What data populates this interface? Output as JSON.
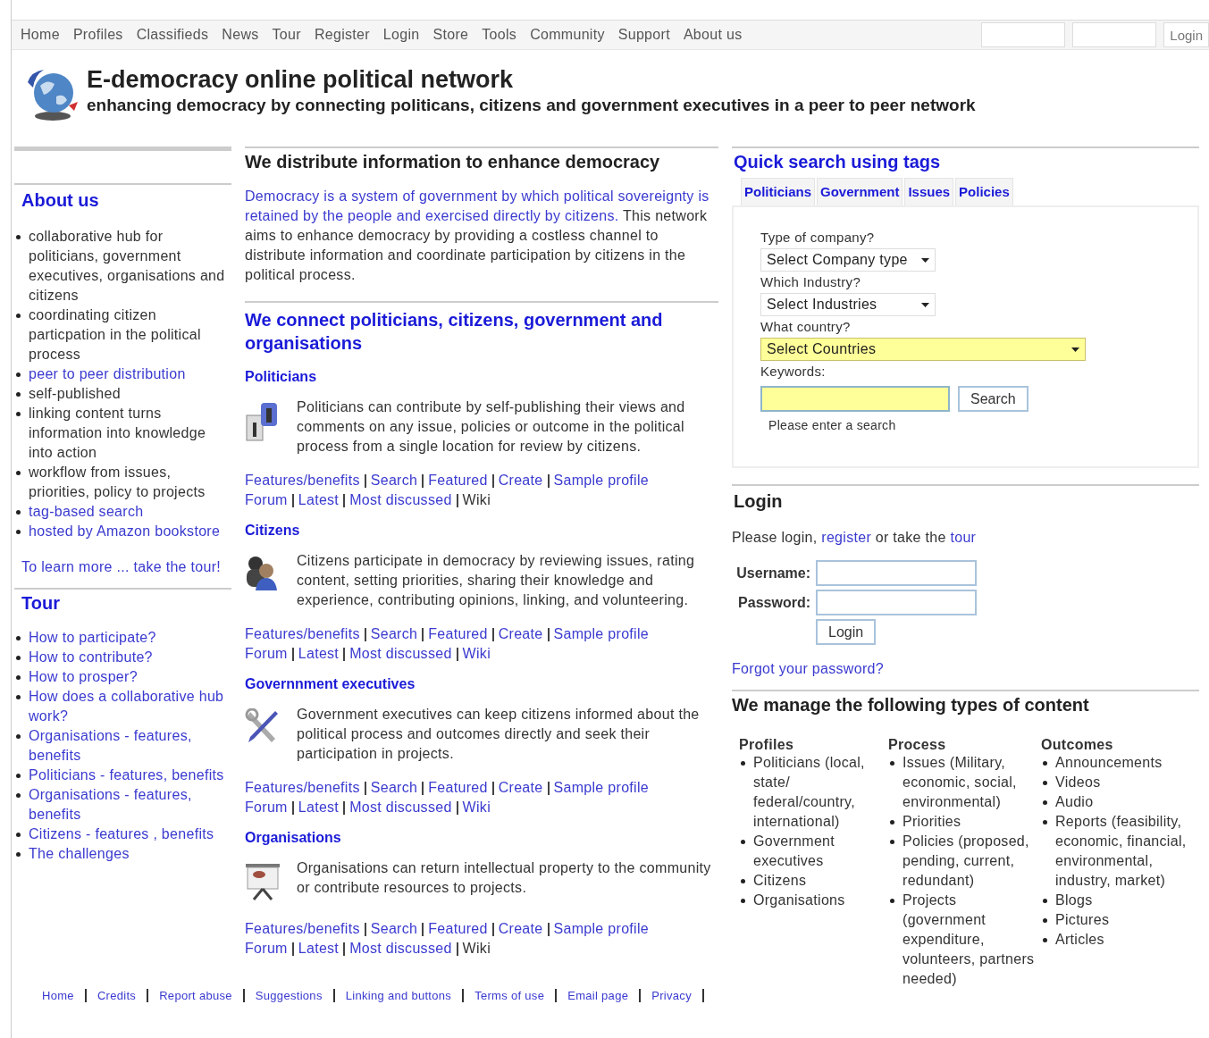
{
  "top_nav": {
    "items": [
      "Home",
      "Profiles",
      "Classifieds",
      "News",
      "Tour",
      "Register",
      "Login",
      "Store",
      "Tools",
      "Community",
      "Support",
      "About us"
    ],
    "login_button": "Login"
  },
  "header": {
    "title": "E-democracy online political network",
    "tagline": "enhancing democracy by connecting politicans, citizens and government executives in a peer to peer network"
  },
  "sidebar": {
    "about": {
      "title": "About us",
      "items": [
        {
          "text": "collaborative hub for politicians, government executives, organisations and citizens",
          "link": false
        },
        {
          "text": "coordinating citizen particpation in the political process",
          "link": false
        },
        {
          "text": "peer to peer distribution",
          "link": true
        },
        {
          "text": "self-published",
          "link": false
        },
        {
          "text": "linking content turns information into knowledge into action",
          "link": false
        },
        {
          "text": "workflow from issues, priorities, policy to projects",
          "link": false
        },
        {
          "text": "tag-based search",
          "link": true
        },
        {
          "text": "hosted by Amazon bookstore",
          "link": true
        }
      ],
      "more_link": "To learn more ... take the tour!"
    },
    "tour": {
      "title": "Tour",
      "items": [
        {
          "text": "How to participate?",
          "link": true
        },
        {
          "text": "How to contribute?",
          "link": true
        },
        {
          "text": "How to prosper?",
          "link": true
        },
        {
          "text": "How does a collaborative hub work?",
          "link": true
        },
        {
          "text": "Organisations - features, benefits",
          "link": true
        },
        {
          "text": "Politicians - features, benefits",
          "link": true
        },
        {
          "text": "Organisations - features, benefits",
          "link": true
        },
        {
          "text": "Citizens - features , benefits",
          "link": true
        },
        {
          "text": "The challenges",
          "link": true
        }
      ]
    }
  },
  "main": {
    "title": "We distribute information to enhance democracy",
    "intro": [
      {
        "text": "Democracy is a system of government by which political sovereignty is",
        "link": true
      },
      {
        "text": "retained by the people and exercised directly by citizens.",
        "link": true
      },
      {
        "text": " This network aims to enhance democracy by providing a costless channel to distribute information and coordinate participation by citizens in the political process.",
        "link": false
      }
    ],
    "connect_title": "We connect politicians, citizens, government and organisations",
    "sections": [
      {
        "kind": "politicians",
        "title": "Politicians",
        "text": "Politicians can contribute by self-publishing their views and comments on any issue, policies or outcome in the political process from a single location for review by citizens.",
        "links": [
          [
            {
              "text": "Features/benefits",
              "link": true
            },
            {
              "text": "Search",
              "link": true
            },
            {
              "text": "Featured",
              "link": true
            },
            {
              "text": "Create",
              "link": true
            },
            {
              "text": "Sample profile",
              "link": true
            }
          ],
          [
            {
              "text": "Forum",
              "link": true
            },
            {
              "text": "Latest",
              "link": true
            },
            {
              "text": "Most discussed",
              "link": true
            },
            {
              "text": "Wiki",
              "link": false
            }
          ]
        ]
      },
      {
        "kind": "citizens",
        "title": "Citizens",
        "text": "Citizens participate in democracy by reviewing issues, rating content, setting priorities, sharing their knowledge and experience, contributing opinions, linking, and volunteering.",
        "links": [
          [
            {
              "text": "Features/benefits",
              "link": true
            },
            {
              "text": "Search",
              "link": true
            },
            {
              "text": "Featured",
              "link": true
            },
            {
              "text": "Create",
              "link": true
            },
            {
              "text": "Sample profile",
              "link": true
            }
          ],
          [
            {
              "text": "Forum",
              "link": true
            },
            {
              "text": "Latest",
              "link": true
            },
            {
              "text": "Most discussed",
              "link": true
            },
            {
              "text": "Wiki",
              "link": true
            }
          ]
        ]
      },
      {
        "kind": "government",
        "title": "Governnment executives",
        "text": "Government executives can keep citizens informed about the political process and outcomes directly and seek their participation in projects.",
        "links": [
          [
            {
              "text": "Features/benefits",
              "link": true
            },
            {
              "text": "Search",
              "link": true
            },
            {
              "text": "Featured",
              "link": true
            },
            {
              "text": "Create",
              "link": true
            },
            {
              "text": "Sample profile",
              "link": true
            }
          ],
          [
            {
              "text": "Forum",
              "link": true
            },
            {
              "text": "Latest",
              "link": true
            },
            {
              "text": "Most discussed",
              "link": true
            },
            {
              "text": "Wiki",
              "link": true
            }
          ]
        ]
      },
      {
        "kind": "organisations",
        "title": "Organisations",
        "text": "Organisations can return intellectual property to the community or contribute resources to projects.",
        "links": [
          [
            {
              "text": "Features/benefits",
              "link": true
            },
            {
              "text": "Search",
              "link": true
            },
            {
              "text": "Featured",
              "link": true
            },
            {
              "text": "Create",
              "link": true
            },
            {
              "text": "Sample profile",
              "link": true
            }
          ],
          [
            {
              "text": "Forum",
              "link": true
            },
            {
              "text": "Latest",
              "link": true
            },
            {
              "text": "Most discussed",
              "link": true
            },
            {
              "text": "Wiki",
              "link": false
            }
          ]
        ]
      }
    ]
  },
  "quick_search": {
    "title": "Quick search using tags",
    "tabs": [
      {
        "label": "Politicians",
        "selected": false
      },
      {
        "label": "Government",
        "selected": false
      },
      {
        "label": "Issues",
        "selected": false
      },
      {
        "label": "Policies",
        "selected": false
      }
    ],
    "selects": [
      {
        "label": "Type of company?",
        "value": "Select Company type",
        "highlighted": false
      },
      {
        "label": "Which Industry?",
        "value": "Select Industries",
        "highlighted": false
      },
      {
        "label": "What country?",
        "value": "Select Countries",
        "highlighted": true
      }
    ],
    "keywords_label": "Keywords:",
    "search_button": "Search",
    "hint": "Please enter a search"
  },
  "login": {
    "title": "Login",
    "prompt": [
      {
        "text": "Please login, ",
        "link": false
      },
      {
        "text": "register",
        "link": true
      },
      {
        "text": " or take the ",
        "link": false
      },
      {
        "text": "tour",
        "link": true
      }
    ],
    "username_label": "Username:",
    "password_label": "Password:",
    "button": "Login",
    "forgot": "Forgot your password?"
  },
  "content_types": {
    "title": "We manage the following types of content",
    "columns": [
      {
        "heading": "Profiles",
        "items": [
          "Politicians (local, state/ federal/country, international)",
          "Government executives",
          "Citizens",
          "Organisations"
        ]
      },
      {
        "heading": "Process",
        "items": [
          "Issues (Military, economic, social, environmental)",
          "Priorities",
          "Policies (proposed, pending, current, redundant)",
          "Projects (government expenditure, volunteers, partners needed)"
        ]
      },
      {
        "heading": "Outcomes",
        "items": [
          "Announcements",
          "Videos",
          "Audio",
          "Reports (feasibility, economic, financial, environmental, industry, market)",
          "Blogs",
          "Pictures",
          "Articles"
        ]
      }
    ]
  },
  "footer": [
    "Home",
    "Credits",
    "Report abuse",
    "Suggestions",
    "Linking and buttons",
    "Terms of use",
    "Email page",
    "Privacy"
  ]
}
